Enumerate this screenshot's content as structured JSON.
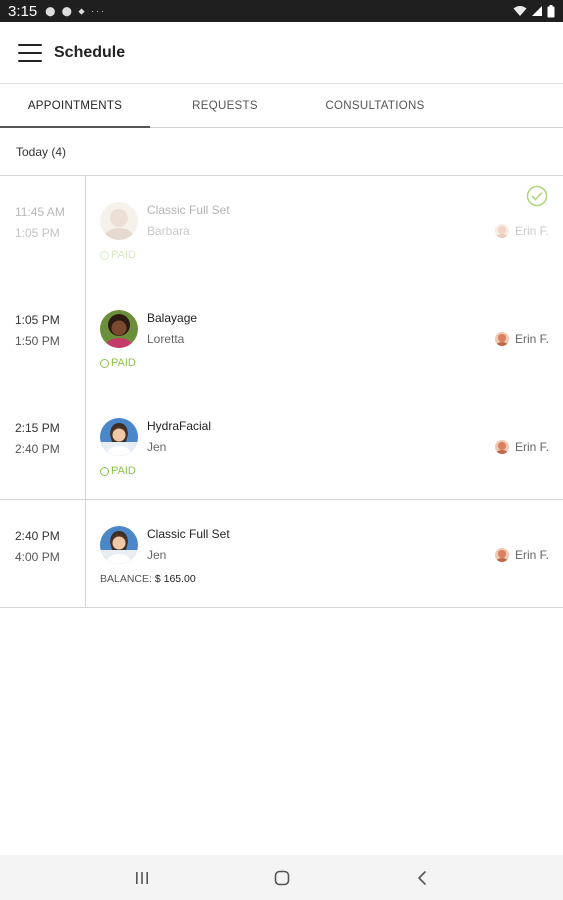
{
  "status_bar": {
    "time": "3:15",
    "notif_icons": "⬤ ⬤ ⬥ ···"
  },
  "header": {
    "title": "Schedule"
  },
  "tabs": [
    {
      "label": "APPOINTMENTS"
    },
    {
      "label": "REQUESTS"
    },
    {
      "label": "CONSULTATIONS"
    }
  ],
  "section": {
    "header": "Today (4)"
  },
  "appointments": [
    {
      "start": "11:45 AM",
      "end": "1:05 PM",
      "service": "Classic Full Set",
      "client": "Barbara",
      "payment": "PAID",
      "staff": "Erin F."
    },
    {
      "start": "1:05 PM",
      "end": "1:50 PM",
      "service": "Balayage",
      "client": "Loretta",
      "payment": "PAID",
      "staff": "Erin F."
    },
    {
      "start": "2:15 PM",
      "end": "2:40 PM",
      "service": "HydraFacial",
      "client": "Jen",
      "payment": "PAID",
      "staff": "Erin F."
    },
    {
      "start": "2:40 PM",
      "end": "4:00 PM",
      "service": "Classic Full Set",
      "client": "Jen",
      "balance_label": "BALANCE:",
      "balance_value": "$ 165.00",
      "staff": "Erin F."
    }
  ],
  "colors": {
    "paid": "#8bc34a",
    "accent": "#222222",
    "divider": "#d5d5d5"
  },
  "icons": [
    "menu-icon",
    "check-circle-icon",
    "recents-icon",
    "home-icon",
    "back-icon",
    "wifi-icon",
    "signal-icon",
    "battery-icon"
  ]
}
